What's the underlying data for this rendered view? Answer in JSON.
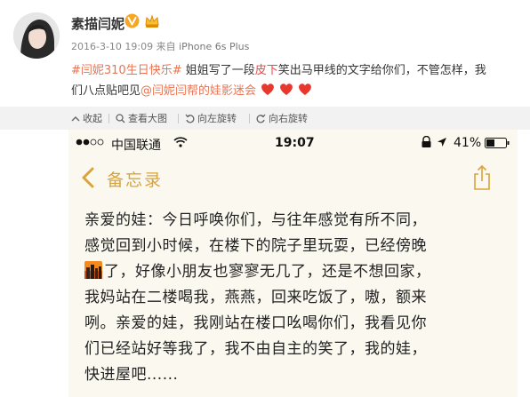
{
  "post": {
    "username": "素描闫妮",
    "time": "2016-3-10 19:09",
    "source_prefix": "来自",
    "device": "iPhone 6s Plus",
    "text_line1_hashtag": "#闫妮310生日快乐#",
    "text_line1_a": " 姐姐写了一段",
    "text_line1_red": "皮下",
    "text_line1_b": "笑出马甲线的文字给你们，不管怎样，我",
    "text_line2_a": "们八点贴吧见",
    "text_line2_link": "@闫妮闫帮的娃影迷会",
    "text_line2_b": " ",
    "heart_count": 3,
    "colors": {
      "accent": "#eb7350",
      "heart": "#e8372c",
      "verified": "#f5a623"
    }
  },
  "toolbar": {
    "collapse": "收起",
    "view_large": "查看大图",
    "rotate_left": "向左旋转",
    "rotate_right": "向右旋转"
  },
  "phone": {
    "status": {
      "carrier": "中国联通",
      "time": "19:07",
      "battery": "41%"
    },
    "nav": {
      "back_label": "备忘录",
      "accent": "#d9a43a"
    },
    "note": {
      "line1": "亲爱的娃：今日呼唤你们，与往年感觉有所不同，",
      "line2": "感觉回到小时候，在楼下的院子里玩耍，已经傍晚",
      "line3": "了，好像小朋友也寥寥无几了，还是不想回家，",
      "line4": "我妈站在二楼喝我，燕燕，回来吃饭了，嗷，额来",
      "line5": "咧。亲爱的娃，我刚站在楼口吆喝你们，我看见你",
      "line6": "们已经站好等我了，我不由自主的笑了，我的娃，",
      "line7": "快进屋吧......"
    }
  }
}
